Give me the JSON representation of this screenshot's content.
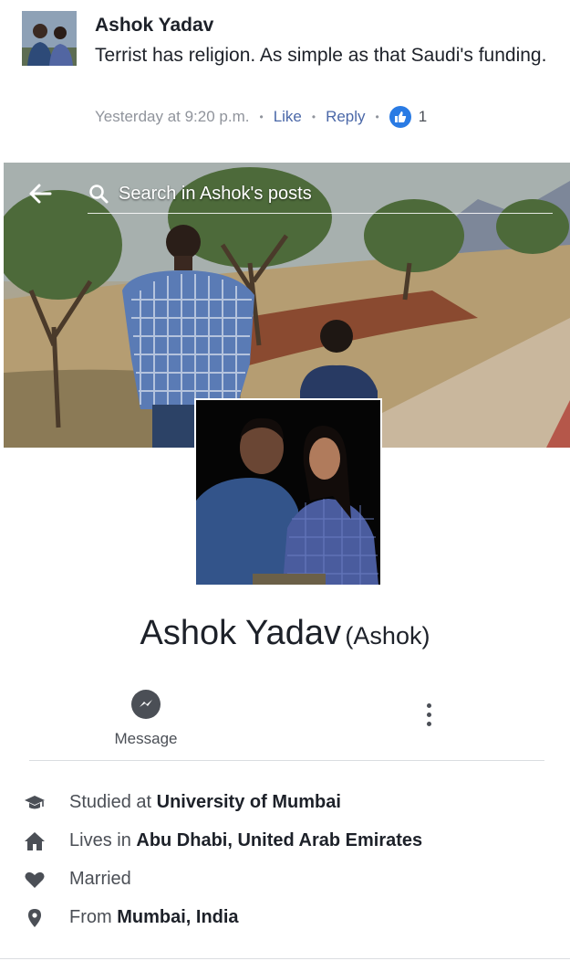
{
  "comment": {
    "author": "Ashok Yadav",
    "text": "Terrist has religion. As simple as that Saudi's funding.",
    "timestamp": "Yesterday at 9:20 p.m.",
    "like_label": "Like",
    "reply_label": "Reply",
    "like_count": "1",
    "separator": "•"
  },
  "header": {
    "search_placeholder": "Search in Ashok's posts"
  },
  "profile": {
    "name": "Ashok Yadav",
    "alternate_name": "(Ashok)"
  },
  "actions": {
    "message_label": "Message"
  },
  "intro": {
    "education_prefix": "Studied at ",
    "education_value": "University of Mumbai",
    "residence_prefix": "Lives in ",
    "residence_value": "Abu Dhabi, United Arab Emirates",
    "relationship": "Married",
    "hometown_prefix": "From ",
    "hometown_value": "Mumbai, India"
  },
  "colors": {
    "link": "#4b68a8",
    "like_badge": "#2a7be4",
    "icon_gray": "#4b4f56",
    "meta_gray": "#90949c"
  },
  "icons": [
    "back-arrow-icon",
    "search-icon",
    "thumbs-up-icon",
    "messenger-icon",
    "more-vertical-icon",
    "graduation-cap-icon",
    "home-icon",
    "heart-icon",
    "location-pin-icon"
  ]
}
